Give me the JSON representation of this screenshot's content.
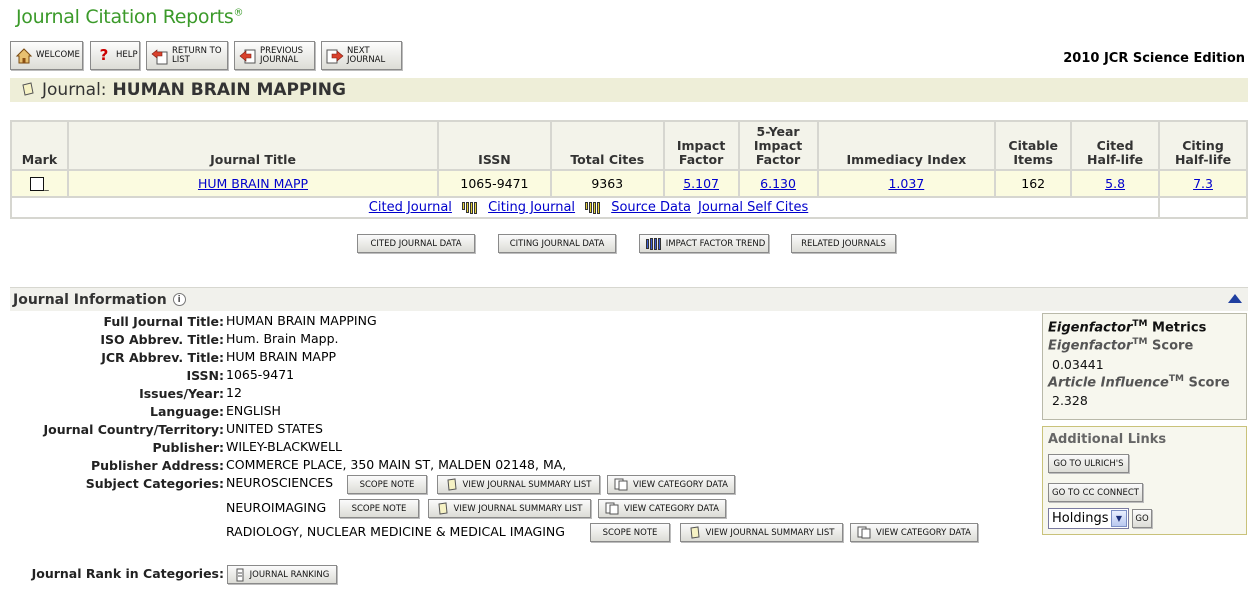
{
  "app": {
    "title": "Journal Citation Reports",
    "reg": "®",
    "edition": "2010 JCR Science Edition"
  },
  "toolbar": {
    "welcome": "WELCOME",
    "help": "HELP",
    "return_l1": "RETURN TO",
    "return_l2": "LIST",
    "prev_l1": "PREVIOUS",
    "prev_l2": "JOURNAL",
    "next_l1": "NEXT",
    "next_l2": "JOURNAL"
  },
  "journal": {
    "label": "Journal:",
    "name": "HUMAN BRAIN MAPPING"
  },
  "table": {
    "headers": {
      "mark": "Mark",
      "title": "Journal Title",
      "issn": "ISSN",
      "total_cites": "Total Cites",
      "if_l1": "Impact",
      "if_l2": "Factor",
      "fy_l1": "5-Year",
      "fy_l2": "Impact",
      "fy_l3": "Factor",
      "immediacy": "Immediacy Index",
      "ci_l1": "Citable",
      "ci_l2": "Items",
      "cited_l1": "Cited",
      "cited_l2": "Half-life",
      "citing_l1": "Citing",
      "citing_l2": "Half-life"
    },
    "row": {
      "title": "HUM BRAIN MAPP",
      "issn": "1065-9471",
      "total_cites": "9363",
      "impact_factor": "5.107",
      "five_year": "6.130",
      "immediacy": "1.037",
      "citable_items": "162",
      "cited_half_life": "5.8",
      "citing_half_life": "7.3"
    },
    "links": {
      "cited": "Cited Journal",
      "citing": "Citing Journal",
      "source": "Source Data",
      "self": "Journal Self Cites"
    }
  },
  "actions": {
    "cited_data": "CITED JOURNAL DATA",
    "citing_data": "CITING JOURNAL DATA",
    "if_trend": "IMPACT FACTOR TREND",
    "related": "RELATED JOURNALS"
  },
  "info": {
    "header": "Journal Information",
    "fields": [
      {
        "label": "Full Journal Title:",
        "value": "HUMAN BRAIN MAPPING"
      },
      {
        "label": "ISO Abbrev. Title:",
        "value": "Hum. Brain Mapp."
      },
      {
        "label": "JCR Abbrev. Title:",
        "value": "HUM BRAIN MAPP"
      },
      {
        "label": "ISSN:",
        "value": "1065-9471"
      },
      {
        "label": "Issues/Year:",
        "value": "12"
      },
      {
        "label": "Language:",
        "value": "ENGLISH"
      },
      {
        "label": "Journal Country/Territory:",
        "value": "UNITED STATES"
      },
      {
        "label": "Publisher:",
        "value": "WILEY-BLACKWELL"
      },
      {
        "label": "Publisher Address:",
        "value": "COMMERCE PLACE, 350 MAIN ST, MALDEN 02148, MA,"
      }
    ],
    "subject_label": "Subject Categories:",
    "categories": [
      "NEUROSCIENCES",
      "NEUROIMAGING",
      "RADIOLOGY, NUCLEAR MEDICINE & MEDICAL IMAGING"
    ],
    "scope_note": "SCOPE NOTE",
    "view_summary": "VIEW JOURNAL SUMMARY LIST",
    "view_category": "VIEW CATEGORY DATA",
    "rank_label": "Journal Rank in Categories:",
    "rank_button": "JOURNAL RANKING"
  },
  "eigen": {
    "title_pre": "Eigenfactor",
    "tm": "TM",
    "title_post": " Metrics",
    "ef_pre": "Eigenfactor",
    "ef_post": " Score",
    "ef_value": "0.03441",
    "ai_pre": "Article Influence",
    "ai_post": " Score",
    "ai_value": "2.328"
  },
  "additional": {
    "title": "Additional Links",
    "ulrich": "GO TO ULRICH'S",
    "cc": "GO TO CC CONNECT",
    "holdings": "Holdings",
    "go": "GO"
  }
}
